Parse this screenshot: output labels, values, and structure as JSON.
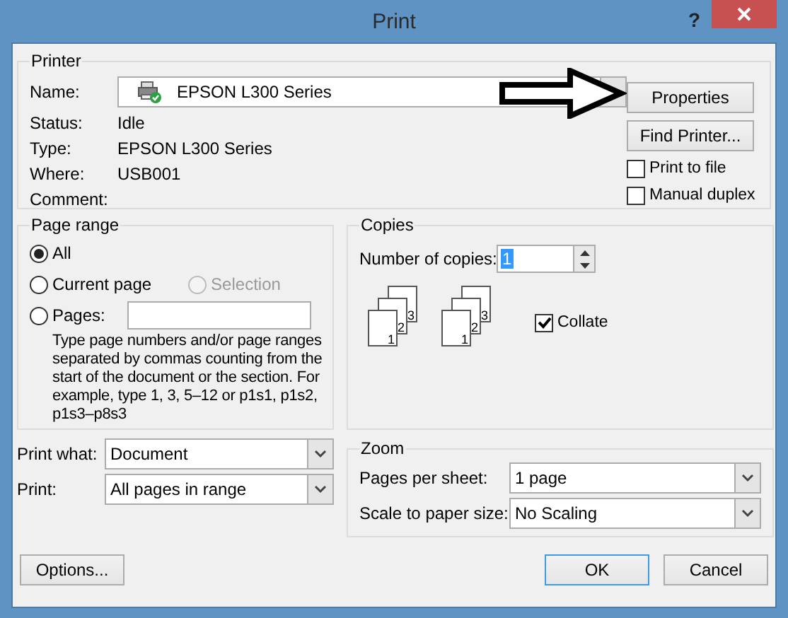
{
  "window": {
    "title": "Print",
    "help": "?"
  },
  "printer": {
    "legend": "Printer",
    "name_label": "Name:",
    "name": "EPSON L300 Series",
    "info": [
      {
        "label": "Status:",
        "value": "Idle"
      },
      {
        "label": "Type:",
        "value": "EPSON L300 Series"
      },
      {
        "label": "Where:",
        "value": "USB001"
      },
      {
        "label": "Comment:"
      }
    ],
    "buttons": [
      "Properties",
      "Find Printer..."
    ],
    "checkboxes": [
      {
        "label": "Print to file",
        "checked": false
      },
      {
        "label": "Manual duplex",
        "checked": false
      }
    ]
  },
  "page_range": {
    "legend": "Page range",
    "options": [
      {
        "label": "All",
        "selected": true,
        "disabled": false
      },
      {
        "label": "Current page",
        "selected": false,
        "disabled": false
      },
      {
        "label": "Selection",
        "selected": false,
        "disabled": true
      },
      {
        "label": "Pages:",
        "selected": false,
        "disabled": false
      }
    ],
    "hint": "Type page numbers and/or page ranges separated by commas counting from the start of the document or the section. For example, type 1, 3, 5–12 or p1s1, p1s2, p1s3–p8s3"
  },
  "copies": {
    "legend": "Copies",
    "label": "Number of copies:",
    "value": "1",
    "stacks": [
      {
        "pages": [
          "3",
          "2",
          "1"
        ]
      },
      {
        "pages": [
          "3",
          "2",
          "1"
        ]
      }
    ],
    "collate": {
      "label": "Collate",
      "checked": true
    }
  },
  "print_options": [
    {
      "label": "Print what:",
      "value": "Document"
    },
    {
      "label": "Print:",
      "value": "All pages in range"
    }
  ],
  "zoom": {
    "legend": "Zoom",
    "rows": [
      {
        "label": "Pages per sheet:",
        "value": "1 page"
      },
      {
        "label": "Scale to paper size:",
        "value": "No Scaling"
      }
    ]
  },
  "buttons": {
    "options": "Options...",
    "ok": "OK",
    "cancel": "Cancel"
  }
}
